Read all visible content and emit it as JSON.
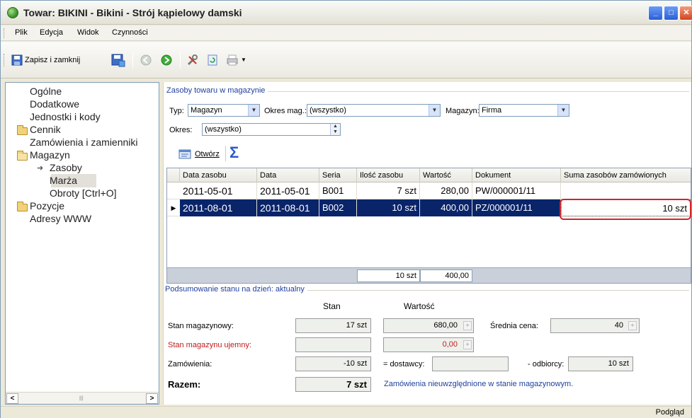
{
  "window": {
    "title": "Towar: BIKINI - Bikini - Strój kąpielowy damski"
  },
  "menu": [
    "Plik",
    "Edycja",
    "Widok",
    "Czynności"
  ],
  "toolbar": {
    "save_close_label": "Zapisz i zamknij"
  },
  "tree": {
    "items": [
      "Ogólne",
      "Dodatkowe",
      "Jednostki i kody",
      "Cennik",
      "Zamówienia i zamienniki",
      "Magazyn",
      "Zasoby",
      "Marża",
      "Obroty [Ctrl+O]",
      "Pozycje",
      "Adresy WWW"
    ]
  },
  "resources": {
    "group_title": "Zasoby towaru w magazynie",
    "type_label": "Typ:",
    "type_value": "Magazyn",
    "period_mag_label": "Okres mag.:",
    "period_mag_value": "(wszystko)",
    "warehouse_label": "Magazyn:",
    "warehouse_value": "Firma",
    "period_label": "Okres:",
    "period_value": "(wszystko)",
    "open_label": "Otwórz",
    "columns": [
      "Data zasobu",
      "Data",
      "Seria",
      "Ilość zasobu",
      "Wartość",
      "Dokument",
      "Suma zasobów zamówionych"
    ],
    "rows": [
      [
        "2011-05-01",
        "2011-05-01",
        "B001",
        "7 szt",
        "280,00",
        "PW/000001/11",
        ""
      ],
      [
        "2011-08-01",
        "2011-08-01",
        "B002",
        "10 szt",
        "400,00",
        "PZ/000001/11",
        "10 szt"
      ]
    ],
    "footer_qty": "10 szt",
    "footer_value": "400,00"
  },
  "summary": {
    "group_title": "Podsumowanie stanu na dzień: aktualny",
    "col_stan": "Stan",
    "col_wartosc": "Wartość",
    "stock_label": "Stan magazynowy:",
    "stock_qty": "17 szt",
    "stock_value": "680,00",
    "avg_price_label": "Średnia cena:",
    "avg_price": "40",
    "negative_label": "Stan magazynu ujemny:",
    "negative_qty": "",
    "negative_value": "0,00",
    "orders_label": "Zamówienia:",
    "orders_qty": "-10 szt",
    "suppliers_label": "= dostawcy:",
    "suppliers_value": "",
    "customers_label": "- odbiorcy:",
    "customers_value": "10 szt",
    "total_label": "Razem:",
    "total_qty": "7 szt",
    "note": "Zamówienia nieuwzględnione w stanie magazynowym.",
    "plus_symbol": "+"
  },
  "status": {
    "right": "Podgląd"
  },
  "colors": {
    "selection": "#0a246a",
    "highlight_outline": "#d2242b",
    "group_title": "#1f3f9e",
    "negative_text": "#c01b1b"
  }
}
